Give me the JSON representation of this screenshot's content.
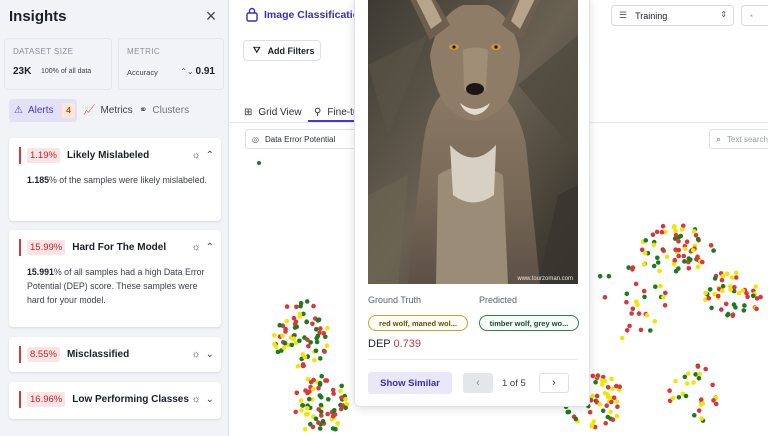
{
  "insights": {
    "title": "Insights",
    "close_icon": "close-icon",
    "dataset_size": {
      "label": "DATASET SIZE",
      "value": "23K",
      "sub": "100% of all data"
    },
    "metric": {
      "label": "METRIC",
      "name": "Accuracy",
      "value": "0.91"
    },
    "tabs": [
      {
        "label": "Alerts",
        "icon": "alert-triangle-icon",
        "count": "4"
      },
      {
        "label": "Metrics",
        "icon": "chart-icon"
      },
      {
        "label": "Clusters",
        "icon": "clusters-icon"
      }
    ],
    "alerts": [
      {
        "pct": "1.19%",
        "title": "Likely Mislabeled",
        "body_bold": "1.185",
        "body": "% of the samples were likely mislabeled.",
        "expanded": true
      },
      {
        "pct": "15.99%",
        "title": "Hard For The Model",
        "body_bold": "15.991",
        "body": "% of all samples had a high Data Error Potential (DEP) score. These samples were hard for your model.",
        "expanded": true
      },
      {
        "pct": "8.55%",
        "title": "Misclassified",
        "expanded": false
      },
      {
        "pct": "16.96%",
        "title": "Low Performing Classes",
        "expanded": false
      }
    ]
  },
  "main": {
    "title": "Image Classification",
    "add_filters": "Add Filters",
    "view_tabs": [
      "Grid View",
      "Fine-tune"
    ],
    "color_by": "Data Error Potential",
    "search_placeholder": "Text search",
    "split_select": "Training",
    "colors": {
      "accent": "#4a39c9",
      "red": "#d9363e",
      "green": "#1f7a1f",
      "yellow": "#f2e600"
    }
  },
  "sample": {
    "photo_credit": "www.tourzoman.com",
    "ground_truth_label": "Ground Truth",
    "predicted_label": "Predicted",
    "ground_truth": "red wolf, maned wol...",
    "predicted": "timber wolf, grey wo...",
    "dep_label": "DEP",
    "dep_value": "0.739",
    "show_similar": "Show Similar",
    "pager": "1 of 5"
  }
}
